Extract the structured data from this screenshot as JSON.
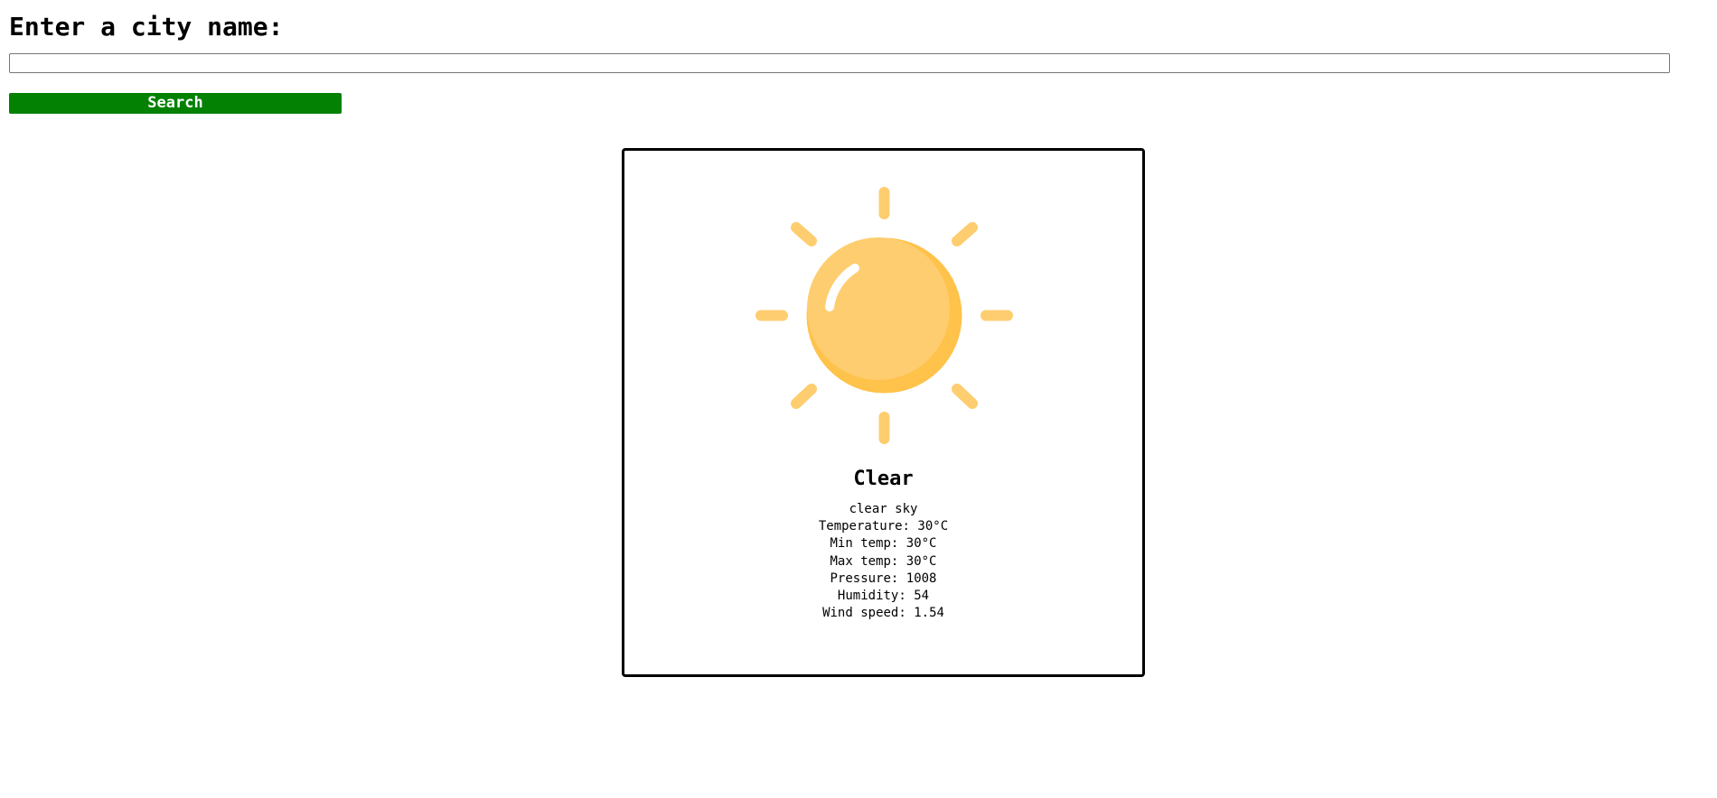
{
  "heading": "Enter a city name:",
  "search": {
    "input_value": "",
    "button_label": "Search",
    "button_color": "#038103"
  },
  "weather": {
    "icon": "sun-icon",
    "icon_color": "#FECD6F",
    "condition": "Clear",
    "description": "clear sky",
    "temperature": "Temperature: 30°C",
    "min_temp": "Min temp: 30°C",
    "max_temp": "Max temp: 30°C",
    "pressure": "Pressure: 1008",
    "humidity": "Humidity: 54",
    "wind_speed": "Wind speed: 1.54"
  }
}
